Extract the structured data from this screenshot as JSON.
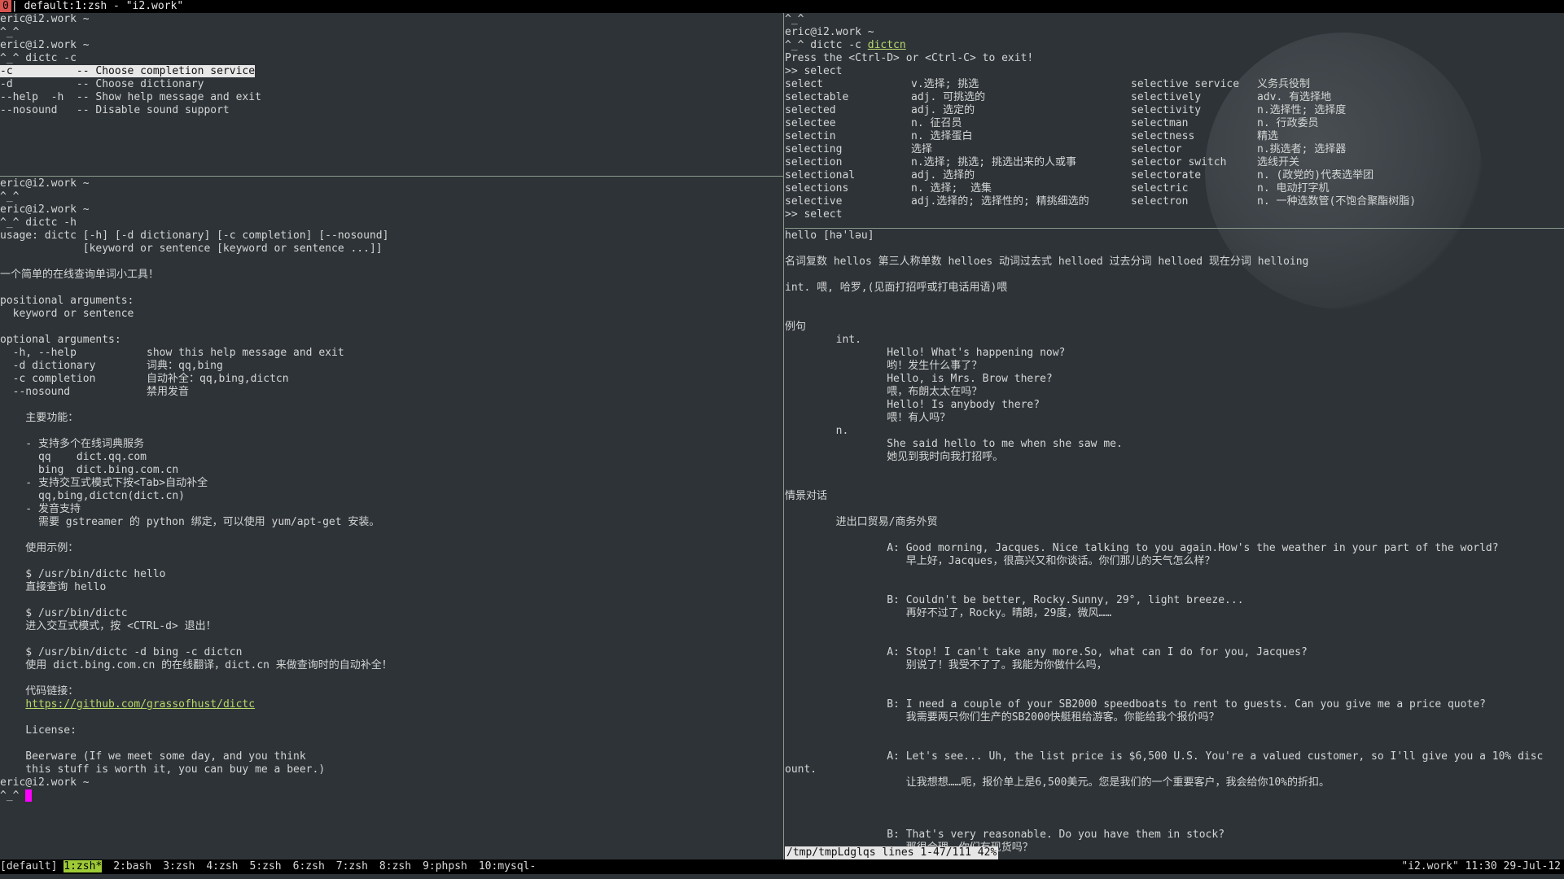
{
  "title_bar": {
    "window_index": "0",
    "title": "| default:1:zsh - \"i2.work\""
  },
  "left_top_pane": {
    "lines": [
      "eric@i2.work ~",
      "^_^",
      "eric@i2.work ~",
      "^_^ dictc -c",
      "-c          -- Choose completion service",
      "-d          -- Choose dictionary",
      "--help  -h  -- Show help message and exit",
      "--nosound   -- Disable sound support"
    ]
  },
  "left_bottom_pane": {
    "lines_before_link": "eric@i2.work ~\n^_^\neric@i2.work ~\n^_^ dictc -h\nusage: dictc [-h] [-d dictionary] [-c completion] [--nosound]\n             [keyword or sentence [keyword or sentence ...]]\n\n一个简单的在线查询单词小工具！\n\npositional arguments:\n  keyword or sentence\n\noptional arguments:\n  -h, --help           show this help message and exit\n  -d dictionary        词典：qq,bing\n  -c completion        自动补全：qq,bing,dictcn\n  --nosound            禁用发音\n\n    主要功能：\n\n    - 支持多个在线词典服务\n      qq    dict.qq.com\n      bing  dict.bing.com.cn\n    - 支持交互式模式下按<Tab>自动补全\n      qq,bing,dictcn(dict.cn)\n    - 发音支持\n      需要 gstreamer 的 python 绑定，可以使用 yum/apt-get 安装。\n\n    使用示例：\n\n    $ /usr/bin/dictc hello\n    直接查询 hello\n\n    $ /usr/bin/dictc\n    进入交互式模式，按 <CTRL-d> 退出！\n\n    $ /usr/bin/dictc -d bing -c dictcn\n    使用 dict.bing.com.cn 的在线翻译，dict.cn 来做查询时的自动补全！\n\n    代码链接：\n",
    "link": "https://github.com/grassofhust/dictc",
    "lines_after_link": "\n    License:\n\n    Beerware (If we meet some day, and you think\n    this stuff is worth it, you can buy me a beer.)\neric@i2.work ~\n^_^ "
  },
  "right_top_pane": {
    "prompt_user": "eric@i2.work ~",
    "command": "^_^ dictc -c ",
    "command_arg": "dictcn",
    "hint": "Press the <Ctrl-D> or <Ctrl-C> to exit!",
    "input1": ">> select",
    "entries": [
      [
        "select",
        "v.选择; 挑选",
        "selective service",
        "义务兵役制"
      ],
      [
        "selectable",
        "adj. 可挑选的",
        "selectively",
        "adv. 有选择地"
      ],
      [
        "selected",
        "adj. 选定的",
        "selectivity",
        "n.选择性; 选择度"
      ],
      [
        "selectee",
        "n. 征召员",
        "selectman",
        "n. 行政委员"
      ],
      [
        "selectin",
        "n. 选择蛋白",
        "selectness",
        "精选"
      ],
      [
        "selecting",
        "选择",
        "selector",
        "n.挑选者; 选择器"
      ],
      [
        "selection",
        "n.选择; 挑选; 挑选出来的人或事",
        "selector switch",
        "选线开关"
      ],
      [
        "selectional",
        "adj. 选择的",
        "selectorate",
        "n. (政党的)代表选举团"
      ],
      [
        "selections",
        "n. 选择;  选集",
        "selectric",
        "n. 电动打字机"
      ],
      [
        "selective",
        "adj.选择的; 选择性的; 精挑细选的",
        "selectron",
        "n. 一种选数管(不饱合聚酯树脂)"
      ]
    ],
    "input2": ">> select"
  },
  "right_bottom_pane": {
    "text": "hello [hə'ləu]\n\n名词复数 hellos 第三人称单数 helloes 动词过去式 helloed 过去分词 helloed 现在分词 helloing\n\nint. 喂, 哈罗,(见面打招呼或打电话用语)喂\n\n\n例句\n        int.\n                Hello! What's happening now?\n                哟！发生什么事了？\n                Hello, is Mrs. Brow there?\n                喂，布朗太太在吗？\n                Hello! Is anybody there?\n                喂！有人吗？\n        n.\n                She said hello to me when she saw me.\n                她见到我时向我打招呼。\n\n\n情景对话\n\n        进出口贸易/商务外贸\n\n                A: Good morning, Jacques. Nice talking to you again.How's the weather in your part of the world?\n                   早上好，Jacques，很高兴又和你谈话。你们那儿的天气怎么样？\n\n\n                B: Couldn't be better, Rocky.Sunny, 29°, light breeze...\n                   再好不过了，Rocky。晴朗，29度，微风……\n\n\n                A: Stop! I can't take any more.So, what can I do for you, Jacques?\n                   别说了！我受不了了。我能为你做什么吗，\n\n\n                B: I need a couple of your SB2000 speedboats to rent to guests. Can you give me a price quote?\n                   我需要两只你们生产的SB2000快艇租给游客。你能给我个报价吗？\n\n\n                A: Let's see... Uh, the list price is $6,500 U.S. You're a valued customer, so I'll give you a 10% disc\nount.\n                   让我想想……呃，报价单上是6,500美元。您是我们的一个重要客户，我会给你10%的折扣。\n\n\n\n                B: That's very reasonable. Do you have them in stock?\n                   那很合理。你们有现货吗？",
    "status": "/tmp/tmpLdglqs lines 1-47/111 42%"
  },
  "tmux_bar": {
    "session": "[default]",
    "windows": [
      "1:zsh*",
      "2:bash",
      "3:zsh",
      "4:zsh",
      "5:zsh",
      "6:zsh",
      "7:zsh",
      "8:zsh",
      "9:phpsh",
      "10:mysql-"
    ],
    "active_index": 0,
    "right": "\"i2.work\" 11:30 29-Jul-12"
  }
}
